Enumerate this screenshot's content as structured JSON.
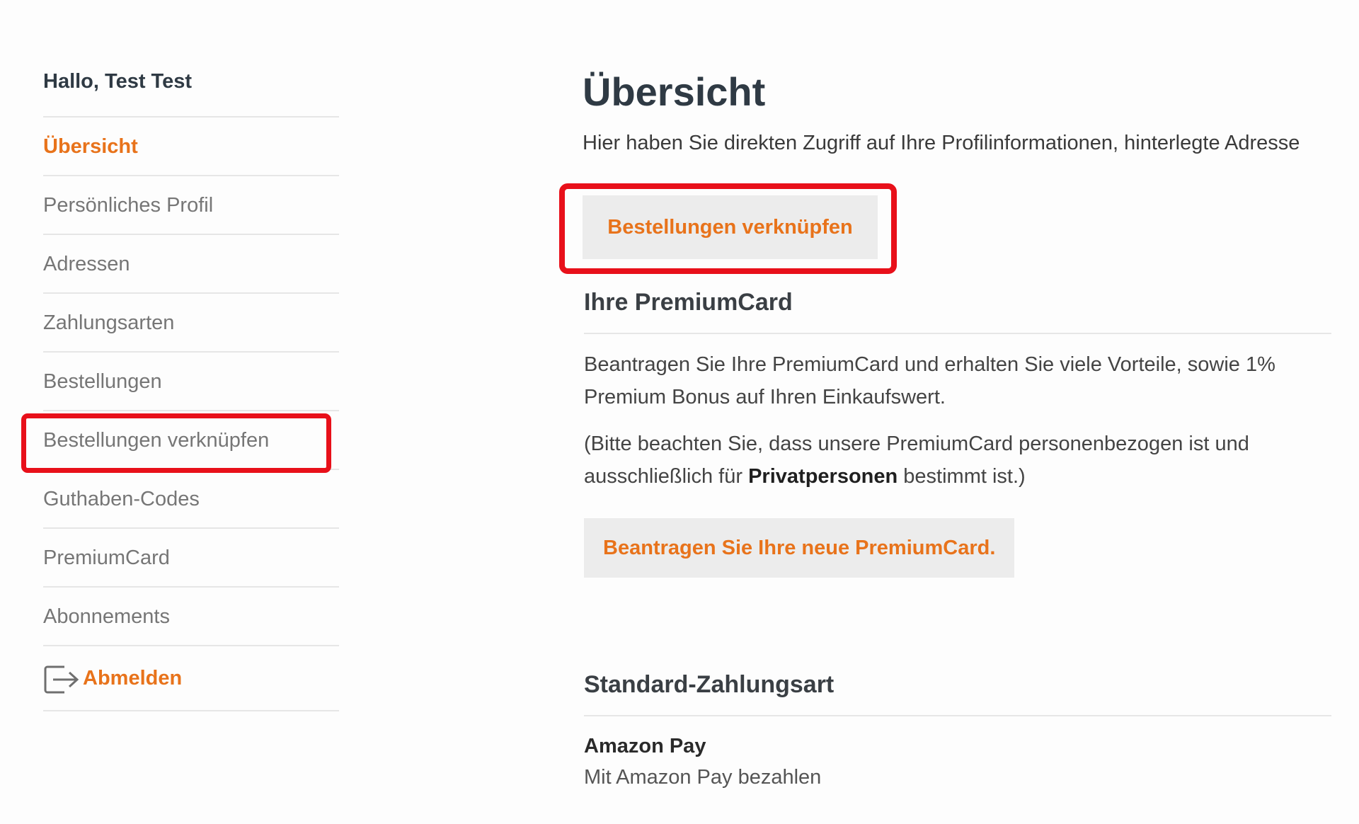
{
  "sidebar": {
    "greeting": "Hallo, Test Test",
    "items": [
      {
        "label": "Übersicht"
      },
      {
        "label": "Persönliches Profil"
      },
      {
        "label": "Adressen"
      },
      {
        "label": "Zahlungsarten"
      },
      {
        "label": "Bestellungen"
      },
      {
        "label": "Bestellungen verknüpfen"
      },
      {
        "label": "Guthaben-Codes"
      },
      {
        "label": "PremiumCard"
      },
      {
        "label": "Abonnements"
      }
    ],
    "logout_label": "Abmelden",
    "logout_icon": "logout-icon"
  },
  "main": {
    "title": "Übersicht",
    "intro": "Hier haben Sie direkten Zugriff auf Ihre Profilinformationen, hinterlegte Adresse",
    "link_orders_button": "Bestellungen verknüpfen",
    "premium": {
      "title": "Ihre PremiumCard",
      "text1": "Beantragen Sie Ihre PremiumCard und erhalten Sie viele Vorteile, sowie 1% Premium Bonus auf Ihren Einkaufswert.",
      "text2_before": "(Bitte beachten Sie, dass unsere PremiumCard personenbezogen ist und ausschließlich für ",
      "text2_bold": "Privatpersonen",
      "text2_after": " bestimmt ist.)",
      "apply_button": "Beantragen Sie Ihre neue PremiumCard."
    },
    "payment": {
      "title": "Standard-Zahlungsart",
      "method_name": "Amazon Pay",
      "method_desc": "Mit Amazon Pay bezahlen"
    }
  },
  "colors": {
    "accent": "#e8731b",
    "highlight": "#e8101a",
    "heading": "#2f3a44",
    "muted": "#767676"
  }
}
